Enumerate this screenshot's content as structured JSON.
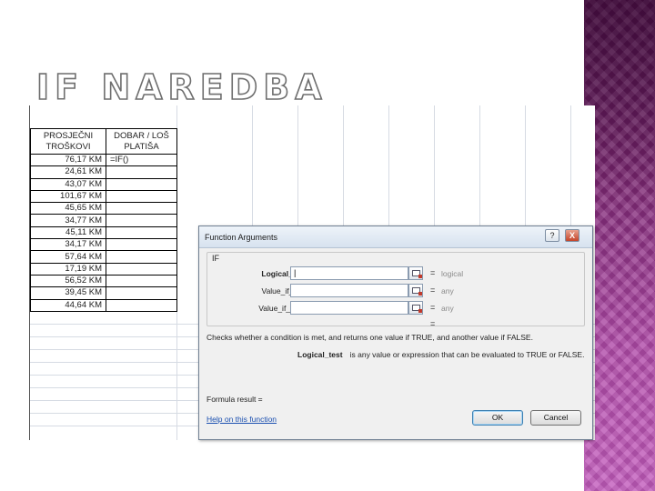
{
  "slide": {
    "title": "IF NAREDBA",
    "accent_color": "#8e3386"
  },
  "spreadsheet": {
    "headers": [
      "PROSJEČNI\nTROŠKOVI",
      "DOBAR / LOŠ\nPLATIŠA"
    ],
    "rows": [
      [
        "76,17 KM",
        "=IF()"
      ],
      [
        "24,61 KM",
        ""
      ],
      [
        "43,07 KM",
        ""
      ],
      [
        "101,67 KM",
        ""
      ],
      [
        "45,65 KM",
        ""
      ],
      [
        "34,77 KM",
        ""
      ],
      [
        "45,11 KM",
        ""
      ],
      [
        "34,17 KM",
        ""
      ],
      [
        "57,64 KM",
        ""
      ],
      [
        "17,19 KM",
        ""
      ],
      [
        "56,52 KM",
        ""
      ],
      [
        "39,45 KM",
        ""
      ],
      [
        "44,64 KM",
        ""
      ]
    ]
  },
  "dialog": {
    "title": "Function Arguments",
    "help_button": "?",
    "close_button": "X",
    "function_name": "IF",
    "arguments": [
      {
        "label": "Logical_test",
        "value": "|",
        "equals": "=",
        "type": "logical",
        "bold": true
      },
      {
        "label": "Value_if_true",
        "value": "",
        "equals": "=",
        "type": "any",
        "bold": false
      },
      {
        "label": "Value_if_false",
        "value": "",
        "equals": "=",
        "type": "any",
        "bold": false
      }
    ],
    "result_equals": "=",
    "description": "Checks whether a condition is met, and returns one value if TRUE, and another value if FALSE.",
    "argument_help_name": "Logical_test",
    "argument_help_text": "is any value or expression that can be evaluated to TRUE or FALSE.",
    "formula_result_label": "Formula result =",
    "help_link": "Help on this function",
    "ok_label": "OK",
    "cancel_label": "Cancel"
  }
}
